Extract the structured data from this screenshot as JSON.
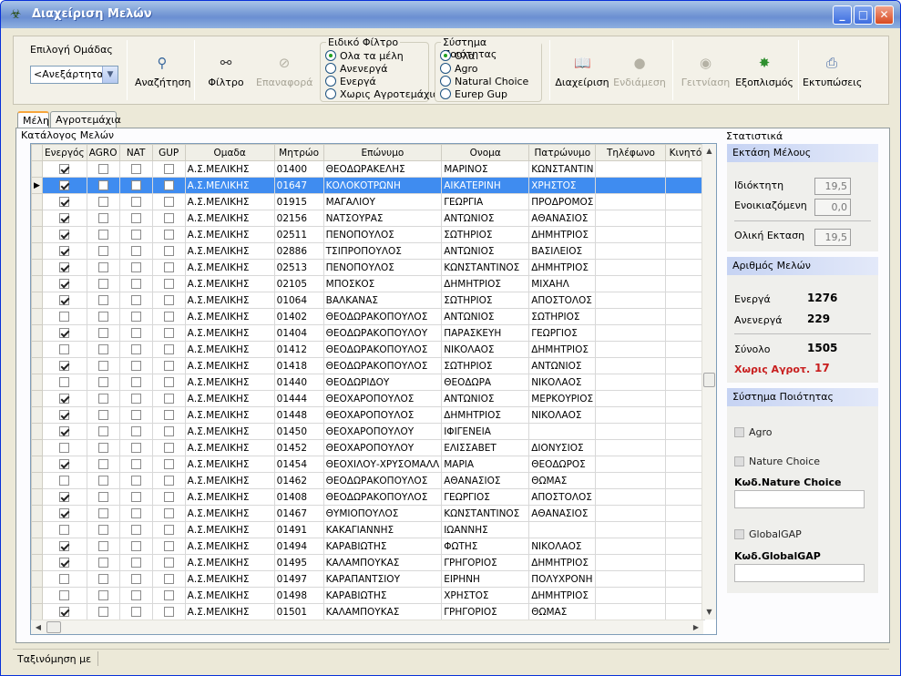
{
  "window": {
    "title": "Διαχείριση Μελών"
  },
  "toolbar": {
    "group_select_label": "Επιλογή Ομάδας",
    "group_select_value": "<Ανεξάρτητα>",
    "search": "Αναζήτηση",
    "filter": "Φίλτρο",
    "reset": "Επαναφορά",
    "manage": "Διαχείριση",
    "intermediate": "Ενδιάμεση",
    "neighbors": "Γειτνίαση",
    "equipment": "Εξοπλισμός",
    "prints": "Εκτυπώσεις",
    "special_filter": {
      "legend": "Ειδικό Φίλτρο",
      "options": [
        "Ολα τα μέλη",
        "Ανενεργά",
        "Ενεργά",
        "Χωρις Αγροτεμάχια"
      ],
      "selected": 0
    },
    "quality_system": {
      "legend": "Σύστημα Ποιότητας",
      "options": [
        "Ολα",
        "Agro",
        "Natural Choice",
        "Eurep Gup"
      ],
      "selected": 0
    }
  },
  "tabs": [
    "Μέλη",
    "Αγροτεμάχια"
  ],
  "grid": {
    "group_label": "Κατάλογος Μελών",
    "columns": [
      "Ενεργός",
      "AGRO",
      "NAT",
      "GUP",
      "Ομαδα",
      "Μητρώο",
      "Επώνυμο",
      "Ονομα",
      "Πατρώνυμο",
      "Τηλέφωνο",
      "Κινητό"
    ],
    "selected_row": 1,
    "rows": [
      [
        true,
        "Α.Σ.ΜΕΛΙΚΗΣ",
        "01400",
        "ΘΕΟΔΩΡΑΚΕΛΗΣ",
        "ΜΑΡΙΝΟΣ",
        "ΚΩΝΣΤΑΝΤΙΝ"
      ],
      [
        true,
        "Α.Σ.ΜΕΛΙΚΗΣ",
        "01647",
        "ΚΟΛΟΚΟΤΡΩΝΗ",
        "ΑΙΚΑΤΕΡΙΝΗ",
        "ΧΡΗΣΤΟΣ"
      ],
      [
        true,
        "Α.Σ.ΜΕΛΙΚΗΣ",
        "01915",
        "ΜΑΓΑΛΙΟΥ",
        "ΓΕΩΡΓΙΑ",
        "ΠΡΟΔΡΟΜΟΣ"
      ],
      [
        true,
        "Α.Σ.ΜΕΛΙΚΗΣ",
        "02156",
        "ΝΑΤΣΟΥΡΑΣ",
        "ΑΝΤΩΝΙΟΣ",
        "ΑΘΑΝΑΣΙΟΣ"
      ],
      [
        true,
        "Α.Σ.ΜΕΛΙΚΗΣ",
        "02511",
        "ΠΕΝΟΠΟΥΛΟΣ",
        "ΣΩΤΗΡΙΟΣ",
        "ΔΗΜΗΤΡΙΟΣ"
      ],
      [
        true,
        "Α.Σ.ΜΕΛΙΚΗΣ",
        "02886",
        "ΤΣΙΠΡΟΠΟΥΛΟΣ",
        "ΑΝΤΩΝΙΟΣ",
        "ΒΑΣΙΛΕΙΟΣ"
      ],
      [
        true,
        "Α.Σ.ΜΕΛΙΚΗΣ",
        "02513",
        "ΠΕΝΟΠΟΥΛΟΣ",
        "ΚΩΝΣΤΑΝΤΙΝΟΣ",
        "ΔΗΜΗΤΡΙΟΣ"
      ],
      [
        true,
        "Α.Σ.ΜΕΛΙΚΗΣ",
        "02105",
        "ΜΠΟΣΚΟΣ",
        "ΔΗΜΗΤΡΙΟΣ",
        "ΜΙΧΑΗΛ"
      ],
      [
        true,
        "Α.Σ.ΜΕΛΙΚΗΣ",
        "01064",
        "ΒΑΛΚΑΝΑΣ",
        "ΣΩΤΗΡΙΟΣ",
        "ΑΠΟΣΤΟΛΟΣ"
      ],
      [
        false,
        "Α.Σ.ΜΕΛΙΚΗΣ",
        "01402",
        "ΘΕΟΔΩΡΑΚΟΠΟΥΛΟΣ",
        "ΑΝΤΩΝΙΟΣ",
        "ΣΩΤΗΡΙΟΣ"
      ],
      [
        true,
        "Α.Σ.ΜΕΛΙΚΗΣ",
        "01404",
        "ΘΕΟΔΩΡΑΚΟΠΟΥΛΟΥ",
        "ΠΑΡΑΣΚΕΥΗ",
        "ΓΕΩΡΓΙΟΣ"
      ],
      [
        false,
        "Α.Σ.ΜΕΛΙΚΗΣ",
        "01412",
        "ΘΕΟΔΩΡΑΚΟΠΟΥΛΟΣ",
        "ΝΙΚΟΛΑΟΣ",
        "ΔΗΜΗΤΡΙΟΣ"
      ],
      [
        true,
        "Α.Σ.ΜΕΛΙΚΗΣ",
        "01418",
        "ΘΕΟΔΩΡΑΚΟΠΟΥΛΟΣ",
        "ΣΩΤΗΡΙΟΣ",
        "ΑΝΤΩΝΙΟΣ"
      ],
      [
        false,
        "Α.Σ.ΜΕΛΙΚΗΣ",
        "01440",
        "ΘΕΟΔΩΡΙΔΟΥ",
        "ΘΕΟΔΩΡΑ",
        "ΝΙΚΟΛΑΟΣ"
      ],
      [
        true,
        "Α.Σ.ΜΕΛΙΚΗΣ",
        "01444",
        "ΘΕΟΧΑΡΟΠΟΥΛΟΣ",
        "ΑΝΤΩΝΙΟΣ",
        "ΜΕΡΚΟΥΡΙΟΣ"
      ],
      [
        true,
        "Α.Σ.ΜΕΛΙΚΗΣ",
        "01448",
        "ΘΕΟΧΑΡΟΠΟΥΛΟΣ",
        "ΔΗΜΗΤΡΙΟΣ",
        "ΝΙΚΟΛΑΟΣ"
      ],
      [
        true,
        "Α.Σ.ΜΕΛΙΚΗΣ",
        "01450",
        "ΘΕΟΧΑΡΟΠΟΥΛΟΥ",
        "ΙΦΙΓΕΝΕΙΑ",
        ""
      ],
      [
        false,
        "Α.Σ.ΜΕΛΙΚΗΣ",
        "01452",
        "ΘΕΟΧΑΡΟΠΟΥΛΟΥ",
        "ΕΛΙΣΣΑΒΕΤ",
        "ΔΙΟΝΥΣΙΟΣ"
      ],
      [
        true,
        "Α.Σ.ΜΕΛΙΚΗΣ",
        "01454",
        "ΘΕΟΧΙΛΟΥ-ΧΡΥΣΟΜΑΛΛ",
        "ΜΑΡΙΑ",
        "ΘΕΟΔΩΡΟΣ"
      ],
      [
        false,
        "Α.Σ.ΜΕΛΙΚΗΣ",
        "01462",
        "ΘΕΟΔΩΡΑΚΟΠΟΥΛΟΣ",
        "ΑΘΑΝΑΣΙΟΣ",
        "ΘΩΜΑΣ"
      ],
      [
        true,
        "Α.Σ.ΜΕΛΙΚΗΣ",
        "01408",
        "ΘΕΟΔΩΡΑΚΟΠΟΥΛΟΣ",
        "ΓΕΩΡΓΙΟΣ",
        "ΑΠΟΣΤΟΛΟΣ"
      ],
      [
        true,
        "Α.Σ.ΜΕΛΙΚΗΣ",
        "01467",
        "ΘΥΜΙΟΠΟΥΛΟΣ",
        "ΚΩΝΣΤΑΝΤΙΝΟΣ",
        "ΑΘΑΝΑΣΙΟΣ"
      ],
      [
        false,
        "Α.Σ.ΜΕΛΙΚΗΣ",
        "01491",
        "ΚΑΚΑΓΙΑΝΝΗΣ",
        "ΙΩΑΝΝΗΣ",
        ""
      ],
      [
        true,
        "Α.Σ.ΜΕΛΙΚΗΣ",
        "01494",
        "ΚΑΡΑΒΙΩΤΗΣ",
        "ΦΩΤΗΣ",
        "ΝΙΚΟΛΑΟΣ"
      ],
      [
        true,
        "Α.Σ.ΜΕΛΙΚΗΣ",
        "01495",
        "ΚΑΛΑΜΠΟΥΚΑΣ",
        "ΓΡΗΓΟΡΙΟΣ",
        "ΔΗΜΗΤΡΙΟΣ"
      ],
      [
        false,
        "Α.Σ.ΜΕΛΙΚΗΣ",
        "01497",
        "ΚΑΡΑΠΑΝΤΣΙΟΥ",
        "ΕΙΡΗΝΗ",
        "ΠΟΛΥΧΡΟΝΗ"
      ],
      [
        false,
        "Α.Σ.ΜΕΛΙΚΗΣ",
        "01498",
        "ΚΑΡΑΒΙΩΤΗΣ",
        "ΧΡΗΣΤΟΣ",
        "ΔΗΜΗΤΡΙΟΣ"
      ],
      [
        true,
        "Α.Σ.ΜΕΛΙΚΗΣ",
        "01501",
        "ΚΑΛΑΜΠΟΥΚΑΣ",
        "ΓΡΗΓΟΡΙΟΣ",
        "ΘΩΜΑΣ"
      ]
    ]
  },
  "stats": {
    "group_label": "Στατιστικά",
    "area": {
      "header": "Εκτάση Μέλους",
      "owned_label": "Ιδιόκτητη",
      "owned_value": "19,5",
      "rented_label": "Ενοικιαζόμενη",
      "rented_value": "0,0",
      "total_label": "Ολική Εκταση",
      "total_value": "19,5"
    },
    "members": {
      "header": "Αριθμός Μελών",
      "active_label": "Ενεργά",
      "active_value": "1276",
      "inactive_label": "Ανενεργά",
      "inactive_value": "229",
      "total_label": "Σύνολο",
      "total_value": "1505",
      "no_fields_label": "Χωρις Αγροτ.",
      "no_fields_value": "17",
      "no_fields_color": "#c81e1e"
    },
    "quality": {
      "header": "Σύστημα Ποιότητας",
      "agro": "Agro",
      "nature": "Nature Choice",
      "nature_code_label": "Κωδ.Nature Choice",
      "global": "GlobalGAP",
      "global_code_label": "Κωδ.GlobalGAP"
    }
  },
  "status": {
    "sort_label": "Ταξινόμηση με"
  },
  "colors": {
    "selection": "#3f8cf0",
    "title_bar": "#6b8fd2"
  }
}
